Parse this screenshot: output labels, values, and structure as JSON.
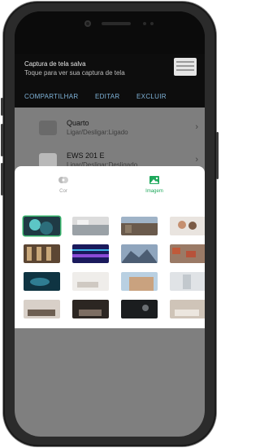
{
  "notification": {
    "title": "Captura de tela salva",
    "subtitle": "Toque para ver sua captura de tela",
    "actions": [
      "COMPARTILHAR",
      "EDITAR",
      "EXCLUIR"
    ],
    "action_color": "#7fb3d8"
  },
  "background_list": [
    {
      "title": "Quarto",
      "subtitle": "Ligar/Desligar:Ligado",
      "icon": "lamp-icon"
    },
    {
      "title": "EWS 201 E",
      "subtitle": "Ligar/Desligar:Desligado",
      "icon": "device-icon"
    }
  ],
  "sheet": {
    "tabs": [
      {
        "label": "Cor",
        "icon": "palette-icon",
        "active": false
      },
      {
        "label": "Imagem",
        "icon": "image-icon",
        "active": true
      }
    ],
    "accent_color": "#1ea85b",
    "selected_index": 0,
    "images": [
      {
        "name": "abstract-teal"
      },
      {
        "name": "kitchen"
      },
      {
        "name": "city-street"
      },
      {
        "name": "couple-in-bed"
      },
      {
        "name": "building-facade"
      },
      {
        "name": "neon-stage"
      },
      {
        "name": "mountains"
      },
      {
        "name": "town-roofs"
      },
      {
        "name": "underwater"
      },
      {
        "name": "white-living-room"
      },
      {
        "name": "house-exterior"
      },
      {
        "name": "bathroom"
      },
      {
        "name": "living-room-sofa"
      },
      {
        "name": "dark-bedroom"
      },
      {
        "name": "dark-lounge"
      },
      {
        "name": "bedroom"
      }
    ]
  }
}
